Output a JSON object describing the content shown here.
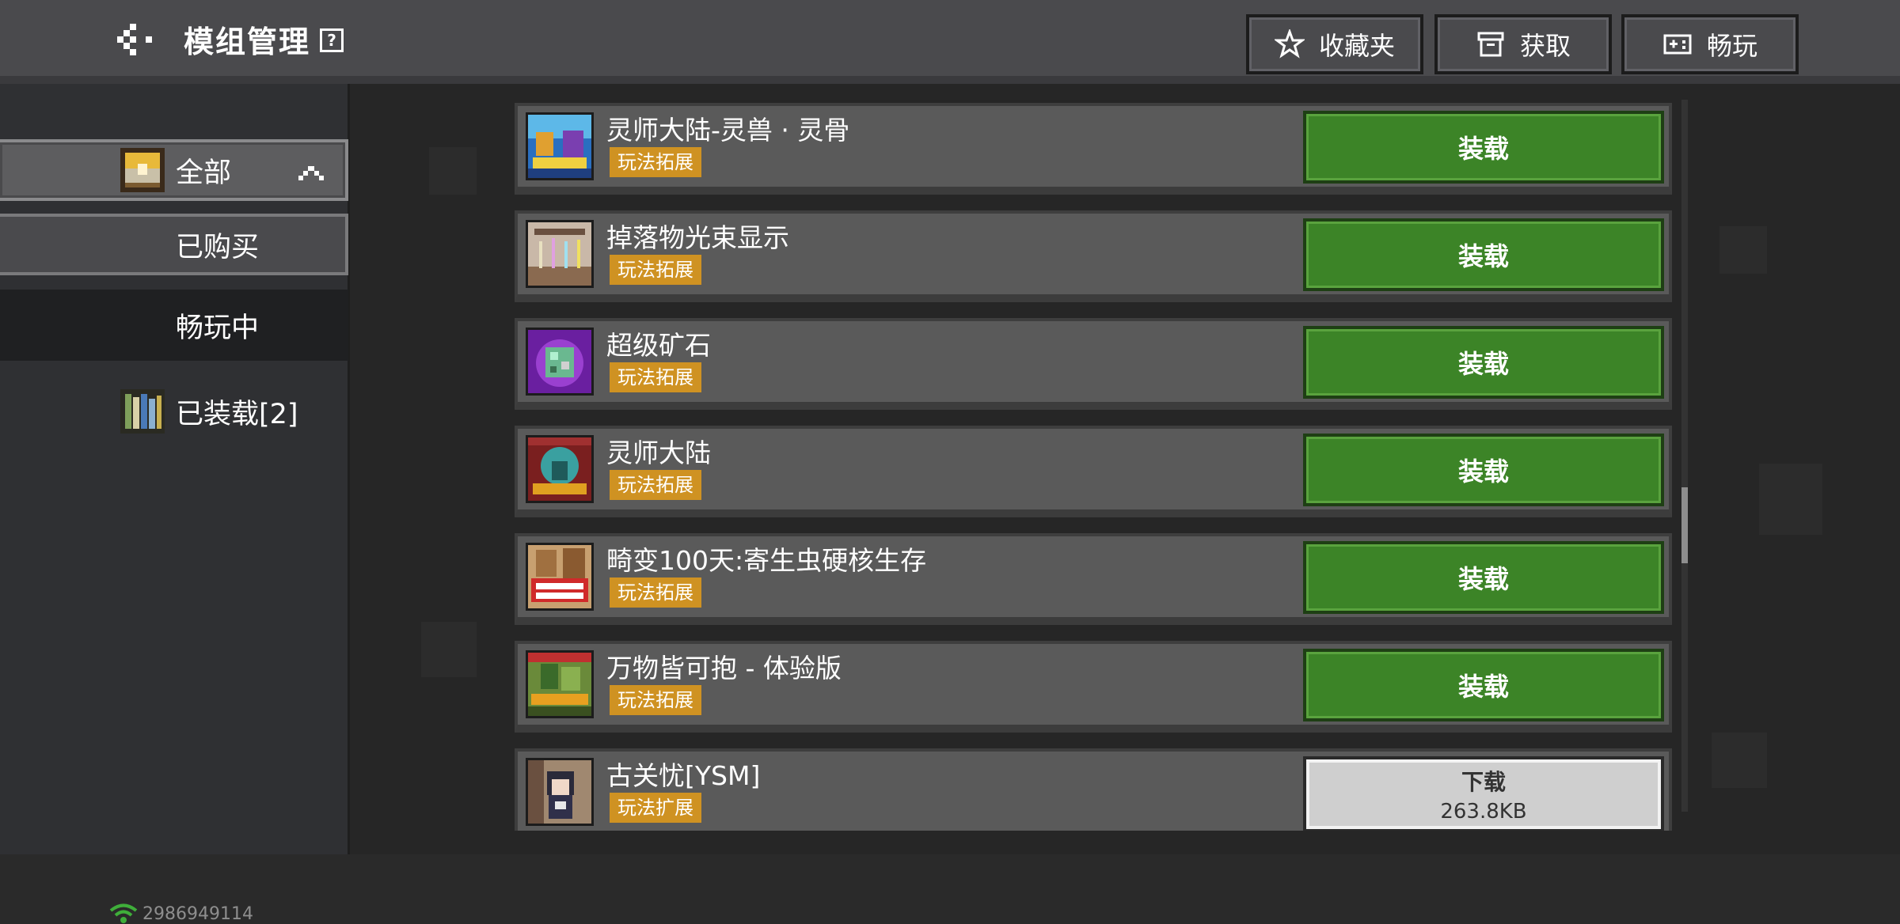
{
  "header": {
    "title": "模组管理",
    "help": "?",
    "favorites_label": "收藏夹",
    "get_label": "获取",
    "play_label": "畅玩"
  },
  "sidebar": {
    "all": "全部",
    "bought": "已购买",
    "playing": "畅玩中",
    "installed": "已装载[2]",
    "user_id": "2986949114"
  },
  "mods": [
    {
      "name": "灵师大陆-灵兽 · 灵骨",
      "tag": "玩法拓展",
      "action": "装载"
    },
    {
      "name": "掉落物光束显示",
      "tag": "玩法拓展",
      "action": "装载"
    },
    {
      "name": "超级矿石",
      "tag": "玩法拓展",
      "action": "装载"
    },
    {
      "name": "灵师大陆",
      "tag": "玩法拓展",
      "action": "装载"
    },
    {
      "name": "畸变100天:寄生虫硬核生存",
      "tag": "玩法拓展",
      "action": "装载"
    },
    {
      "name": "万物皆可抱 - 体验版",
      "tag": "玩法拓展",
      "action": "装载"
    },
    {
      "name": "古关忧[YSM]",
      "tag": "玩法扩展",
      "action": "下载",
      "size": "263.8KB"
    }
  ],
  "colors": {
    "load_green": "#3c8427",
    "tag_orange": "#cf9222",
    "header_bg": "#4a4a4d"
  }
}
